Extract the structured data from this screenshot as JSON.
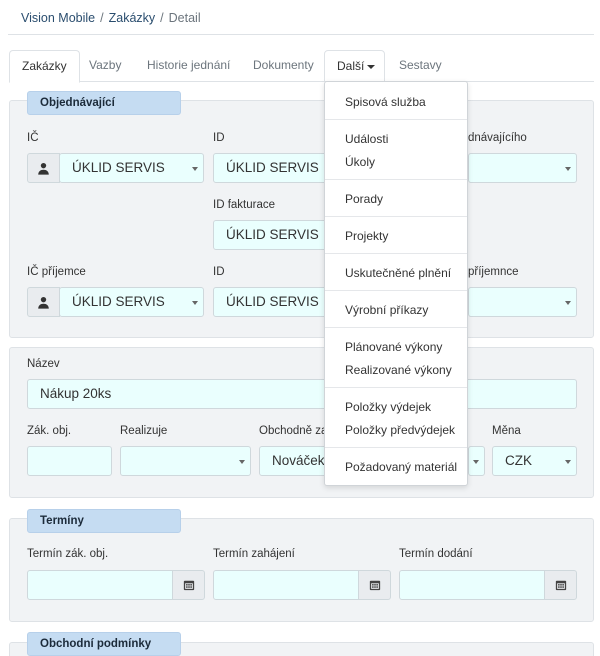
{
  "breadcrumb": {
    "root": "Vision Mobile",
    "section": "Zakázky",
    "current": "Detail",
    "separator": "/"
  },
  "tabs": [
    {
      "label": "Zakázky"
    },
    {
      "label": "Vazby"
    },
    {
      "label": "Historie jednání"
    },
    {
      "label": "Dokumenty"
    },
    {
      "label": "Další"
    },
    {
      "label": "Sestavy"
    }
  ],
  "objednavajici": {
    "title": "Objednávající",
    "ic_label": "IČ",
    "ic_value": "ÚKLID SERVIS",
    "id_label": "ID",
    "id_value": "ÚKLID SERVIS",
    "osoba_label": "dnávajícího",
    "id_fakturace_label": "ID fakturace",
    "id_fakturace_value": "ÚKLID SERVIS",
    "ic_prijemce_label": "IČ příjemce",
    "ic_prijemce_value": "ÚKLID SERVIS",
    "id2_label": "ID",
    "id2_value": "ÚKLID SERVIS",
    "prijemnce_label": "příjemnce"
  },
  "detail": {
    "nazev_label": "Název",
    "nazev_value": "Nákup 20ks",
    "zak_obj_label": "Zák. obj.",
    "realizuje_label": "Realizuje",
    "obchodne_label": "Obchodně za",
    "obchodne_value": "Nováček",
    "mena_label": "Měna",
    "mena_value": "CZK"
  },
  "terminy": {
    "title": "Termíny",
    "zak_obj_label": "Termín zák. obj.",
    "zahajeni_label": "Termín zahájení",
    "dodani_label": "Termín dodání"
  },
  "obchodni": {
    "title": "Obchodní podmínky"
  },
  "menu": {
    "items": [
      "Spisová služba",
      "Události",
      "Úkoly",
      "Porady",
      "Projekty",
      "Uskutečněné plnění",
      "Výrobní příkazy",
      "Plánované výkony",
      "Realizované výkony",
      "Položky výdejek",
      "Položky předvýdejek",
      "Požadovaný materiál"
    ]
  },
  "icons": {
    "person": "person-icon",
    "calendar": "calendar-icon",
    "caret": "caret-down-icon"
  }
}
